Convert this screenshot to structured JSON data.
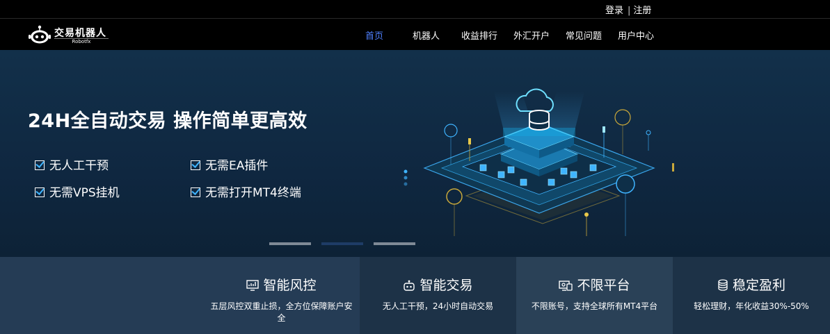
{
  "topbar": {
    "login": "登录",
    "separator": "|",
    "register": "注册"
  },
  "logo": {
    "brand": "交易机器人",
    "sub": "Robotfx"
  },
  "nav": [
    {
      "label": "首页",
      "active": true
    },
    {
      "label": "机器人"
    },
    {
      "label": "收益排行"
    },
    {
      "label": "外汇开户"
    },
    {
      "label": "常见问题"
    },
    {
      "label": "用户中心"
    }
  ],
  "hero": {
    "title": "24H全自动交易 操作简单更高效",
    "features": [
      "无人工干预",
      "无需EA插件",
      "无需VPS挂机",
      "无需打开MT4终端"
    ],
    "carousel": {
      "slides": 3,
      "active": 2
    }
  },
  "features": [
    {
      "icon": "monitor-chart-icon",
      "title": "智能风控",
      "desc": "五层风控双重止损，全方位保障账户安全"
    },
    {
      "icon": "robot-icon",
      "title": "智能交易",
      "desc": "无人工干预，24小时自动交易"
    },
    {
      "icon": "device-icon",
      "title": "不限平台",
      "desc": "不限账号，支持全球所有MT4平台"
    },
    {
      "icon": "coins-icon",
      "title": "稳定盈利",
      "desc": "轻松理财，年化收益30%-50%"
    }
  ],
  "colors": {
    "accent": "#4f80ff",
    "check": "#3fb4ff",
    "hero_bg": "#12304a",
    "bar_bg": "#253c55"
  }
}
